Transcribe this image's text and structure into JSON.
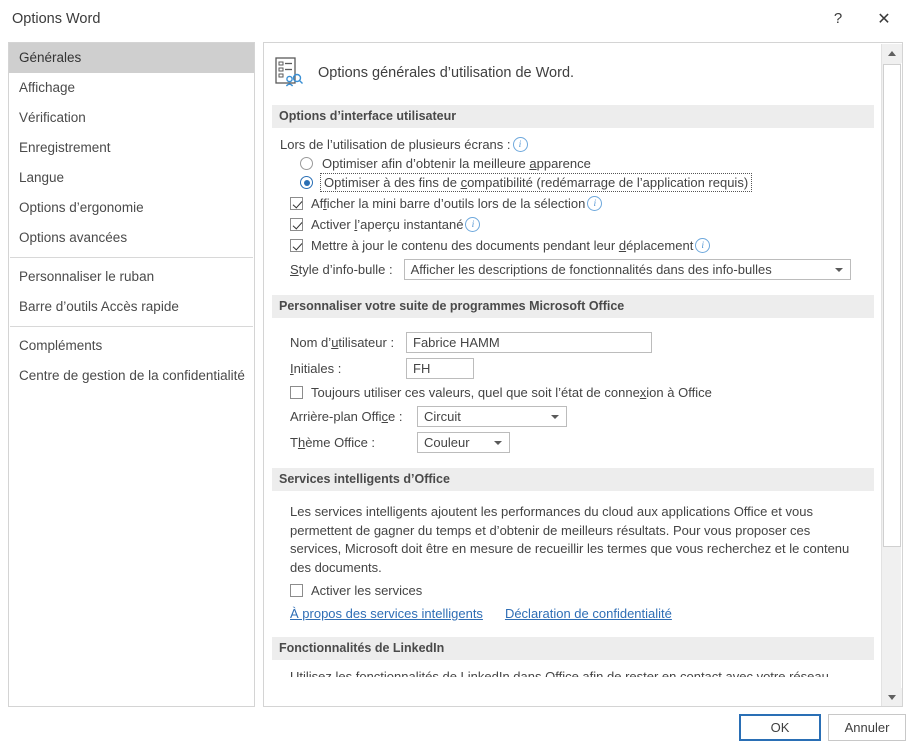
{
  "window": {
    "title": "Options Word",
    "help_label": "?",
    "close_label": "✕"
  },
  "sidebar": {
    "items": [
      {
        "label": "Générales",
        "selected": true
      },
      {
        "label": "Affichage",
        "selected": false
      },
      {
        "label": "Vérification",
        "selected": false
      },
      {
        "label": "Enregistrement",
        "selected": false
      },
      {
        "label": "Langue",
        "selected": false
      },
      {
        "label": "Options d’ergonomie",
        "selected": false
      },
      {
        "label": "Options avancées",
        "selected": false
      },
      {
        "label": "Personnaliser le ruban",
        "selected": false
      },
      {
        "label": "Barre d’outils Accès rapide",
        "selected": false
      },
      {
        "label": "Compléments",
        "selected": false
      },
      {
        "label": "Centre de gestion de la confidentialité",
        "selected": false
      }
    ]
  },
  "pane": {
    "header": "Options générales d’utilisation de Word.",
    "header_icon": "general-options-icon",
    "sections": {
      "ui_options": {
        "title": "Options d’interface utilisateur",
        "multiscreen_label": "Lors de l’utilisation de plusieurs écrans :",
        "radios": [
          {
            "label_pre": "Optimiser afin d’obtenir la meilleure ",
            "accel": "a",
            "label_post": "pparence",
            "checked": false,
            "focused": false
          },
          {
            "label_pre": "Optimiser à des fins de ",
            "accel": "c",
            "label_post": "ompatibilité (redémarrage de l’application requis)",
            "checked": true,
            "focused": true
          }
        ],
        "checkboxes": [
          {
            "label_pre": "Af",
            "accel": "f",
            "label_post": "icher la mini barre d’outils lors de la sélection",
            "checked": true,
            "info": true
          },
          {
            "label_pre": "Activer ",
            "accel": "l",
            "label_post": "’aperçu instantané",
            "checked": true,
            "info": true
          },
          {
            "label_pre": "Mettre à jour le contenu des documents pendant leur ",
            "accel": "d",
            "label_post": "éplacement",
            "checked": true,
            "info": true
          }
        ],
        "tooltip_style": {
          "label_pre": "",
          "accel": "S",
          "label_post": "tyle d’info-bulle :",
          "value": "Afficher les descriptions de fonctionnalités dans des info-bulles"
        }
      },
      "personalize": {
        "title": "Personnaliser votre suite de programmes Microsoft Office",
        "username": {
          "label_pre": "Nom d’",
          "accel": "u",
          "label_post": "tilisateur :",
          "value": "Fabrice HAMM"
        },
        "initials": {
          "label_pre": "",
          "accel": "I",
          "label_post": "nitiales :",
          "value": "FH"
        },
        "always_use": {
          "label_pre": "Toujours utiliser ces valeurs, quel que soit l’état de conne",
          "accel": "x",
          "label_post": "ion à Office",
          "checked": false
        },
        "background": {
          "label_pre": "Arrière-plan Offi",
          "accel": "c",
          "label_post": "e :",
          "value": "Circuit"
        },
        "theme": {
          "label_pre": "T",
          "accel": "h",
          "label_post": "ème Office :",
          "value": "Couleur"
        }
      },
      "intelligent_services": {
        "title": "Services intelligents d’Office",
        "description": "Les services intelligents ajoutent les performances du cloud aux applications Office et vous permettent de gagner du temps et d’obtenir de meilleurs résultats. Pour vous proposer ces services, Microsoft doit être en mesure de recueillir les termes que vous recherchez et le contenu des documents.",
        "enable_checkbox": {
          "label": "Activer les services",
          "checked": false
        },
        "links": [
          "À propos des services intelligents",
          "Déclaration de confidentialité"
        ]
      },
      "linkedin": {
        "title": "Fonctionnalités de LinkedIn",
        "description": "Utilisez les fonctionnalités de LinkedIn dans Office afin de rester en contact avec votre réseau"
      }
    }
  },
  "footer": {
    "ok_label": "OK",
    "cancel_label": "Annuler"
  },
  "colors": {
    "accent": "#2a6fb5",
    "link": "#2f6eb5",
    "section_band": "#ededed",
    "sidebar_selected": "#cfcfcf"
  }
}
